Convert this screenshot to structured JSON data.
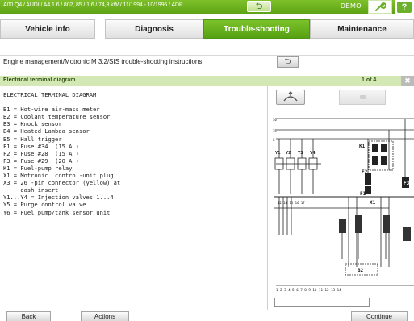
{
  "topbar": {
    "breadcrumb": "A00 Q4 / AUDI / A4 1.6 / 802, 85 / 1.6 / 74,8 kW / 11/1994 - 10/1996 / ADP",
    "back_icon": "back-arrow-icon",
    "demo_label": "DEMO",
    "tool_icon": "wrench-icon",
    "help_label": "?"
  },
  "tabs": [
    {
      "label": "Vehicle info",
      "active": false
    },
    {
      "label": "Diagnosis",
      "active": false
    },
    {
      "label": "Trouble-shooting",
      "active": true
    },
    {
      "label": "Maintenance",
      "active": false
    }
  ],
  "instruction_bar": {
    "text": "Engine management/Motronic M 3.2/SIS trouble-shooting instructions",
    "button_icon": "back-arrow-icon"
  },
  "section": {
    "title": "Electrical terminal diagram",
    "page": "1 of 4"
  },
  "legend": [
    "ELECTRICAL TERMINAL DIAGRAM",
    "",
    "B1 = Hot-wire air-mass meter",
    "B2 = Coolant temperature sensor",
    "B3 = Knock sensor",
    "B4 = Heated Lambda sensor",
    "B5 = Hall trigger",
    "F1 = Fuse #34  (15 A )",
    "F2 = Fuse #28  (15 A )",
    "F3 = Fuse #29  (20 A )",
    "K1 = Fuel-pump relay",
    "X1 = Motronic  control-unit plug",
    "X3 = 26 -pin connector (yellow) at",
    "     dash insert",
    "Y1...Y4 = Injection valves 1...4",
    "Y5 = Purge control valve",
    "Y6 = Fuel pump/tank sensor unit"
  ],
  "diagram_labels": {
    "k1": "K1",
    "f1": "F1",
    "f2": "F2",
    "f3": "F3",
    "x1": "X1",
    "b2": "B2",
    "y1": "Y1",
    "y2": "Y2",
    "y3": "Y3",
    "y4": "Y4",
    "pins": "1 2 3 4 5 6 7 8 9 10 11 12 13 14"
  },
  "bottom": {
    "back": "Back",
    "actions": "Actions",
    "continue": "Continue"
  },
  "colors": {
    "accent_green": "#6bb12a",
    "section_green": "#d3e8b4"
  }
}
